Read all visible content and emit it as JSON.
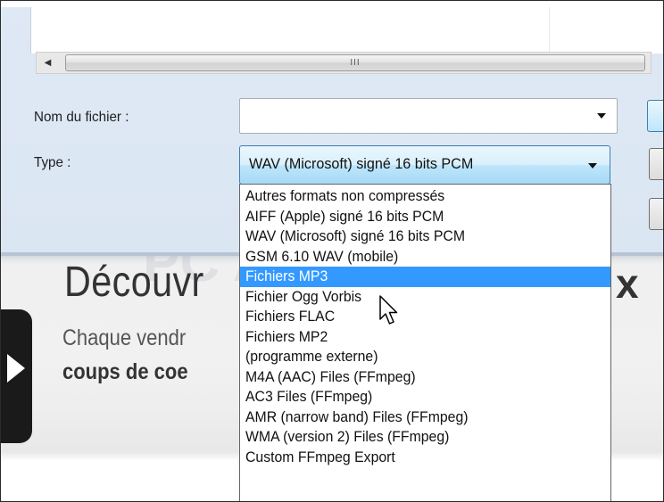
{
  "dialog": {
    "filename_label": "Nom du fichier :",
    "filename_value": "",
    "type_label": "Type :",
    "type_selected": "WAV (Microsoft) signé 16 bits PCM",
    "scrollbar_grip": "III"
  },
  "dropdown": {
    "items": [
      "Autres formats non compressés",
      "AIFF (Apple) signé 16 bits PCM",
      "WAV (Microsoft) signé 16 bits PCM",
      "GSM 6.10 WAV (mobile)",
      "Fichiers MP3",
      "Fichier Ogg Vorbis",
      "Fichiers FLAC",
      "Fichiers MP2",
      "(programme externe)",
      "M4A (AAC) Files (FFmpeg)",
      "AC3 Files (FFmpeg)",
      "AMR (narrow band) Files (FFmpeg)",
      "WMA (version 2) Files (FFmpeg)",
      "Custom FFmpeg Export"
    ],
    "highlighted_index": 4
  },
  "background_page": {
    "heading": "Découvr",
    "heading_right": "x",
    "subtitle": "Chaque vendr",
    "bold_line": "coups de coe"
  },
  "colors": {
    "highlight": "#3399ff",
    "dialog_bg": "#dbe6f3"
  }
}
